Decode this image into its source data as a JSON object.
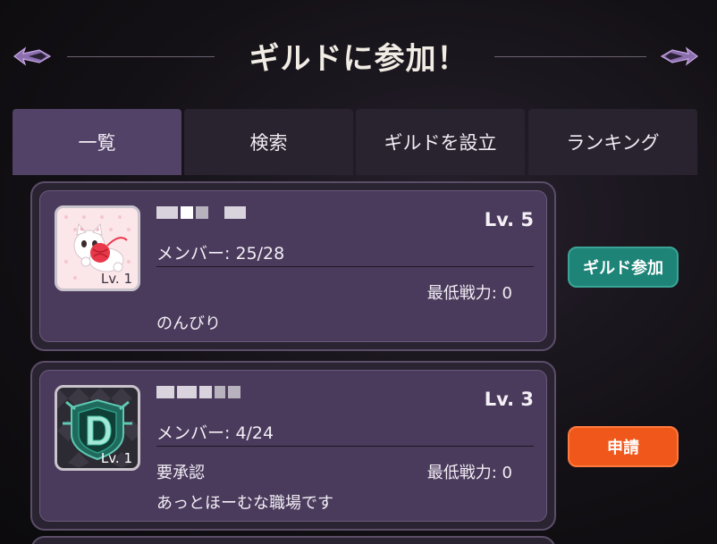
{
  "header": {
    "title": "ギルドに参加！"
  },
  "icons": {
    "ornament_left": "wing-ornament-icon",
    "ornament_right": "wing-ornament-icon"
  },
  "colors": {
    "accent_purple": "#524268",
    "join_button": "#1e8477",
    "apply_button": "#f0571b"
  },
  "tabs": [
    {
      "label": "一覧",
      "active": true
    },
    {
      "label": "検索",
      "active": false
    },
    {
      "label": "ギルドを設立",
      "active": false
    },
    {
      "label": "ランキング",
      "active": false
    }
  ],
  "guilds": [
    {
      "emblem": "cat-emblem",
      "emblem_level": "Lv. 1",
      "level": "Lv. 5",
      "members": "メンバー: 25/28",
      "requirement": "",
      "min_power": "最低戦力: 0",
      "description": "のんびり",
      "action": "ギルド参加"
    },
    {
      "emblem": "letter-d-emblem",
      "emblem_level": "Lv. 1",
      "level": "Lv. 3",
      "members": "メンバー: 4/24",
      "requirement": "要承認",
      "min_power": "最低戦力: 0",
      "description": "あっとほーむな職場です",
      "action": "申請"
    }
  ]
}
